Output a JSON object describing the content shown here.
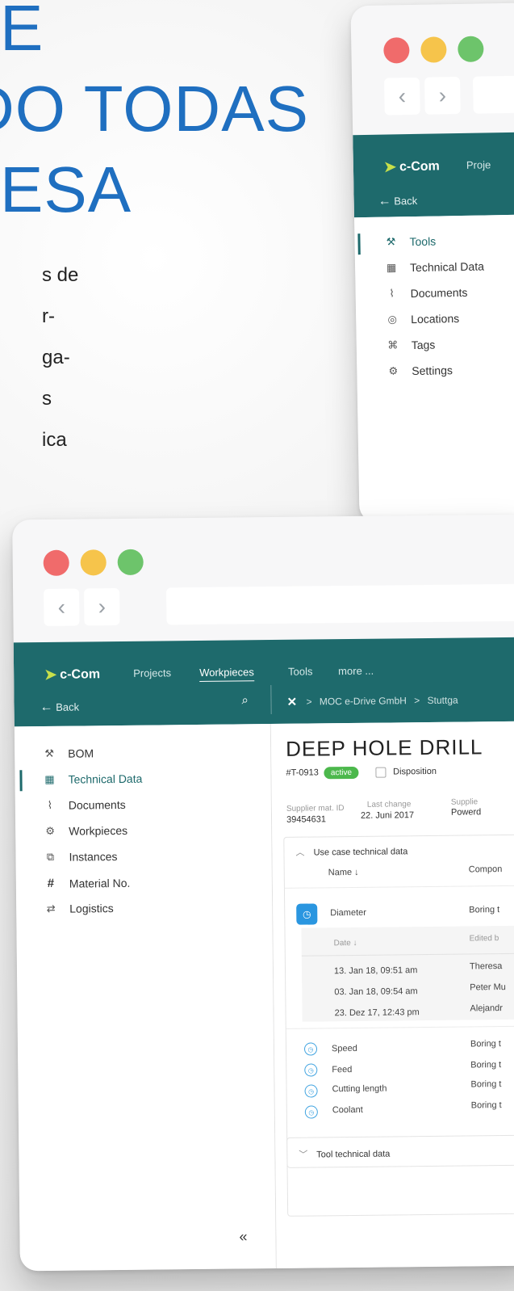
{
  "hero": {
    "lines": [
      "E",
      "DO TODAS",
      "ESA"
    ],
    "paragraph": [
      "s de",
      "r-",
      "ga-",
      "s",
      "ica"
    ]
  },
  "top_window": {
    "logo": "c-Com",
    "nav_partial": "Proje",
    "back_label": "Back",
    "sidebar": [
      {
        "label": "Tools",
        "icon": "wrench-icon",
        "glyph": "⚒",
        "active": true
      },
      {
        "label": "Technical Data",
        "icon": "document-grid-icon",
        "glyph": "▦",
        "active": false
      },
      {
        "label": "Documents",
        "icon": "paperclip-icon",
        "glyph": "⌇",
        "active": false
      },
      {
        "label": "Locations",
        "icon": "location-pin-icon",
        "glyph": "◎",
        "active": false
      },
      {
        "label": "Tags",
        "icon": "tag-icon",
        "glyph": "⌘",
        "active": false
      },
      {
        "label": "Settings",
        "icon": "sliders-icon",
        "glyph": "⚙",
        "active": false
      }
    ]
  },
  "main_window": {
    "logo": "c-Com",
    "nav": {
      "projects": "Projects",
      "workpieces": "Workpieces",
      "tools": "Tools",
      "more": "more ..."
    },
    "back_label": "Back",
    "breadcrumb": {
      "company": "MOC e-Drive GmbH",
      "location": "Stuttga"
    },
    "collapse_glyph": "«",
    "sidebar": [
      {
        "label": "BOM",
        "icon": "wrench-icon",
        "glyph": "⚒",
        "active": false
      },
      {
        "label": "Technical Data",
        "icon": "document-grid-icon",
        "glyph": "▦",
        "active": true
      },
      {
        "label": "Documents",
        "icon": "paperclip-icon",
        "glyph": "⌇",
        "active": false
      },
      {
        "label": "Workpieces",
        "icon": "workpiece-icon",
        "glyph": "⚙",
        "active": false
      },
      {
        "label": "Instances",
        "icon": "instances-icon",
        "glyph": "⧉",
        "active": false
      },
      {
        "label": "Material No.",
        "icon": "hash-icon",
        "glyph": "#",
        "active": false
      },
      {
        "label": "Logistics",
        "icon": "logistics-icon",
        "glyph": "⇄",
        "active": false
      }
    ],
    "detail": {
      "title": "DEEP HOLE DRILL",
      "id": "#T-0913",
      "status": "active",
      "disposition_label": "Disposition",
      "supplier_mat_id_label": "Supplier mat. ID",
      "supplier_mat_id": "39454631",
      "last_change_label": "Last change",
      "last_change": "22. Juni 2017",
      "supplier_label": "Supplie",
      "supplier_value": "Powerd",
      "use_case_section": "Use case technical data",
      "name_header": "Name ↓",
      "component_header": "Compon",
      "diameter": {
        "name": "Diameter",
        "value": "Boring t"
      },
      "history_headers": {
        "date": "Date ↓",
        "edited_by": "Edited b"
      },
      "history": [
        {
          "date": "13. Jan 18, 09:51 am",
          "editor": "Theresa"
        },
        {
          "date": "03. Jan 18, 09:54 am",
          "editor": "Peter Mu"
        },
        {
          "date": "23. Dez 17, 12:43 pm",
          "editor": "Alejandr"
        }
      ],
      "params": [
        {
          "name": "Speed",
          "value": "Boring t"
        },
        {
          "name": "Feed",
          "value": "Boring t"
        },
        {
          "name": "Cutting length",
          "value": "Boring t"
        },
        {
          "name": "Coolant",
          "value": "Boring t"
        }
      ],
      "tool_section": "Tool technical data"
    }
  },
  "colors": {
    "brand_teal": "#1e6a6c",
    "accent_blue": "#1f6fc0",
    "status_green": "#4cb84c",
    "dot_red": "#f06b6b",
    "dot_yellow": "#f6c44b",
    "dot_green": "#6dc46b"
  }
}
